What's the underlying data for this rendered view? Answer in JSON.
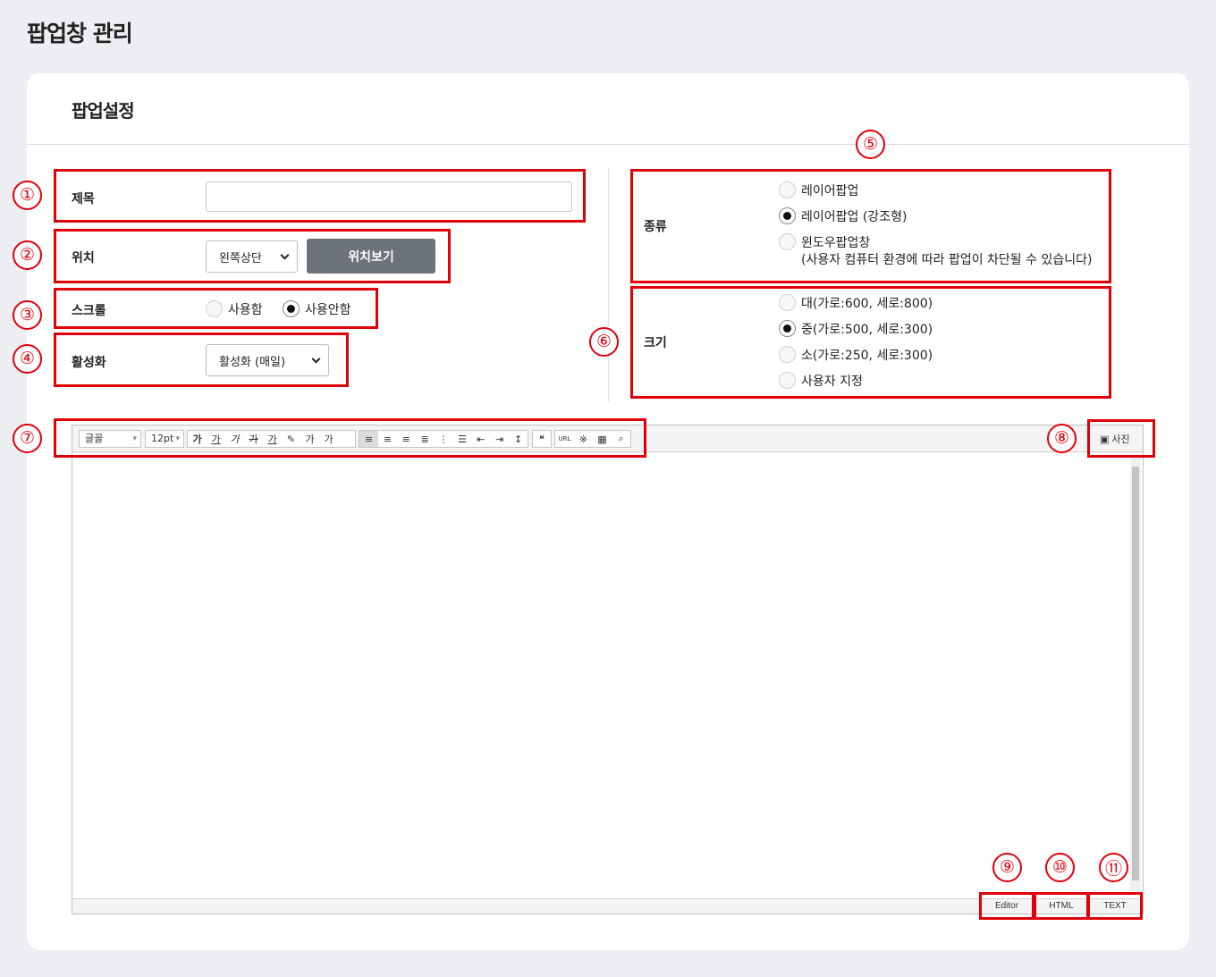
{
  "page_title": "팝업창 관리",
  "card_title": "팝업설정",
  "fields": {
    "title_label": "제목",
    "title_value": "",
    "position_label": "위치",
    "position_select": "왼쪽상단",
    "position_preview_button": "위치보기",
    "scroll_label": "스크롤",
    "scroll_options": [
      "사용함",
      "사용안함"
    ],
    "scroll_selected": "사용안함",
    "activation_label": "활성화",
    "activation_select": "활성화 (매일)",
    "type_label": "종류",
    "type_options": [
      "레이어팝업",
      "레이어팝업 (강조형)",
      "윈도우팝업창"
    ],
    "type_note": "(사용자 컴퓨터 환경에 따라 팝업이 차단될 수 있습니다)",
    "type_selected": "레이어팝업 (강조형)",
    "size_label": "크기",
    "size_options": [
      "대(가로:600, 세로:800)",
      "중(가로:500, 세로:300)",
      "소(가로:250, 세로:300)",
      "사용자 지정"
    ],
    "size_selected": "중(가로:500, 세로:300)"
  },
  "editor": {
    "font_select": "글꼴",
    "size_select": "12pt",
    "format_buttons": [
      "가",
      "가",
      "가",
      "가",
      "가",
      "가",
      "가"
    ],
    "photo_button": "사진",
    "url_button": "URL",
    "modes": [
      "Editor",
      "HTML",
      "TEXT"
    ]
  },
  "annotations": [
    "①",
    "②",
    "③",
    "④",
    "⑤",
    "⑥",
    "⑦",
    "⑧",
    "⑨",
    "⑩",
    "⑪"
  ],
  "colors": {
    "annotation": "#e0000a",
    "dark_button": "#6c737a",
    "background": "#eceef1"
  }
}
